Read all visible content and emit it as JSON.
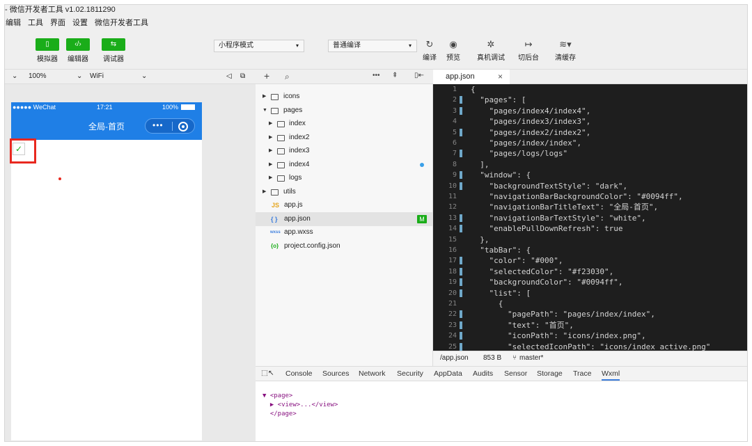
{
  "window": {
    "title": "- 微信开发者工具 v1.02.1811290"
  },
  "menu": [
    "编辑",
    "工具",
    "界面",
    "设置",
    "微信开发者工具"
  ],
  "toolbar": {
    "simulator_label": "模拟器",
    "editor_label": "编辑器",
    "debugger_label": "调试器",
    "mode_select": "小程序模式",
    "compile_select": "普通编译",
    "compile_label": "编译",
    "preview_label": "预览",
    "remote_debug_label": "真机调试",
    "background_label": "切后台",
    "clear_cache_label": "清缓存"
  },
  "sim_controls": {
    "zoom": "100%",
    "network": "WiFi"
  },
  "phone": {
    "carrier": "●●●●● WeChat",
    "time": "17:21",
    "battery": "100%",
    "nav_title": "全局-首页",
    "checkmark": "✓"
  },
  "file_tree": {
    "items": [
      {
        "name": "icons",
        "kind": "folder",
        "open": false
      },
      {
        "name": "pages",
        "kind": "folder",
        "open": true
      },
      {
        "name": "index",
        "kind": "folder",
        "open": false
      },
      {
        "name": "index2",
        "kind": "folder",
        "open": false
      },
      {
        "name": "index3",
        "kind": "folder",
        "open": false
      },
      {
        "name": "index4",
        "kind": "folder",
        "open": false
      },
      {
        "name": "logs",
        "kind": "folder",
        "open": false
      },
      {
        "name": "utils",
        "kind": "folder",
        "open": false
      },
      {
        "name": "app.js",
        "kind": "file",
        "icon": "JS"
      },
      {
        "name": "app.json",
        "kind": "file",
        "icon": "{ }",
        "badge": "M"
      },
      {
        "name": "app.wxss",
        "kind": "file",
        "icon": "wxss"
      },
      {
        "name": "project.config.json",
        "kind": "file",
        "icon": "{o}"
      }
    ]
  },
  "editor": {
    "tab": "app.json",
    "lines": [
      "{",
      "  \"pages\": [",
      "    \"pages/index4/index4\",",
      "    \"pages/index3/index3\",",
      "    \"pages/index2/index2\",",
      "    \"pages/index/index\",",
      "    \"pages/logs/logs\"",
      "  ],",
      "  \"window\": {",
      "    \"backgroundTextStyle\": \"dark\",",
      "    \"navigationBarBackgroundColor\": \"#0094ff\",",
      "    \"navigationBarTitleText\": \"全局-首页\",",
      "    \"navigationBarTextStyle\": \"white\",",
      "    \"enablePullDownRefresh\": true",
      "  },",
      "  \"tabBar\": {",
      "    \"color\": \"#000\",",
      "    \"selectedColor\": \"#f23030\",",
      "    \"backgroundColor\": \"#0094ff\",",
      "    \"list\": [",
      "      {",
      "        \"pagePath\": \"pages/index/index\",",
      "        \"text\": \"首页\",",
      "        \"iconPath\": \"icons/index.png\",",
      "        \"selectedIconPath\": \"icons/index_active.png\""
    ],
    "status_path": "/app.json",
    "status_size": "853 B",
    "status_branch": "master*"
  },
  "devtools": {
    "tabs": [
      "Console",
      "Sources",
      "Network",
      "Security",
      "AppData",
      "Audits",
      "Sensor",
      "Storage",
      "Trace",
      "Wxml"
    ],
    "active_tab": "Wxml",
    "wxml": [
      "▼ <page>",
      "  ▶ <view>...</view>",
      "  </page>"
    ]
  },
  "colors": {
    "accent_green": "#1aad19",
    "nav_blue": "#1f7fe6",
    "highlight_red": "#e8281f"
  }
}
